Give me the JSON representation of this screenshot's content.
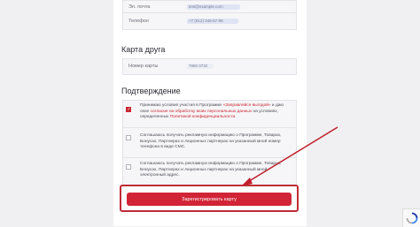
{
  "contact": {
    "email_label": "Эл. почта",
    "email_value": "test@example.com",
    "phone_label": "Телефон",
    "phone_value": "+7 (912) 345-67-89"
  },
  "friend_card": {
    "heading": "Карта друга",
    "number_label": "Номер карты",
    "number_value": "7980 0732"
  },
  "confirmation": {
    "heading": "Подтверждение",
    "items": [
      {
        "checked": true,
        "text_before": "Принимаю условия участия в Программе ",
        "link1": "«Заправляйся выгодой»",
        "text_mid1": " и даю свое ",
        "link2": "согласие на обработку моих персональных данных",
        "text_mid2": " на условиях, определенных ",
        "link3": "Политикой конфиденциальности",
        "text_after": "."
      },
      {
        "checked": false,
        "text": "Соглашаюсь получать рекламную информацию о Программе, Товарах, Бонусах, Партнерах и Акционных партнерах на указанный мной номер телефона в виде СМС."
      },
      {
        "checked": false,
        "text": "Соглашаюсь получать рекламную информацию о Программе, Товарах, Бонусах, Партнерах и Акционных партнерах на указанный мной электронный адрес."
      }
    ]
  },
  "submit": {
    "label": "Зарегистрировать карту"
  },
  "colors": {
    "accent": "#d12436",
    "outline": "#c02b37",
    "arrow": "#c0202c"
  }
}
